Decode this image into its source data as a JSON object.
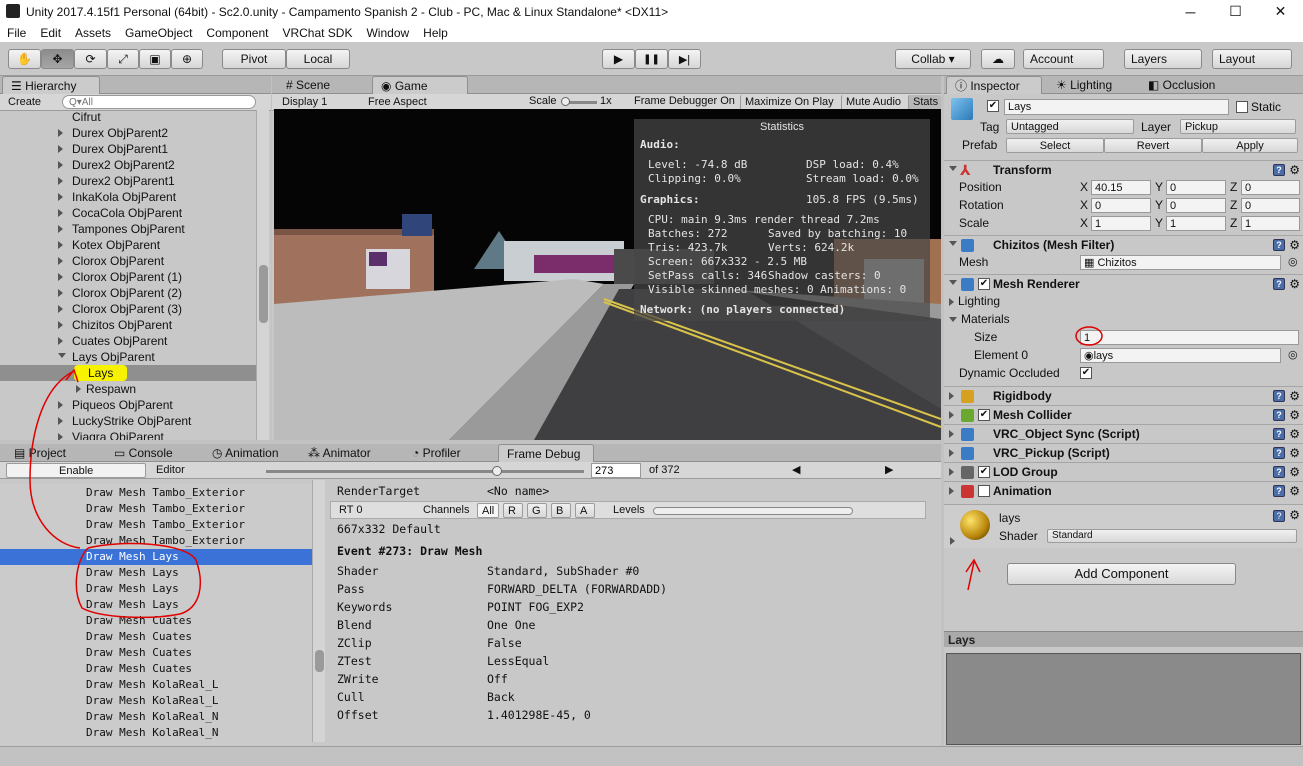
{
  "window": {
    "title": "Unity 2017.4.15f1 Personal (64bit) - Sc2.0.unity - Campamento Spanish 2 - Club - PC, Mac & Linux Standalone* <DX11>",
    "minimize": "─",
    "maximize": "☐",
    "close": "✕"
  },
  "menu": [
    "File",
    "Edit",
    "Assets",
    "GameObject",
    "Component",
    "VRChat SDK",
    "Window",
    "Help"
  ],
  "toolbar": {
    "tools": [
      "✋",
      "✥",
      "⟳",
      "⤢",
      "▣",
      "⊕"
    ],
    "pivot": "Pivot",
    "local": "Local",
    "play": "▶",
    "pause": "❚❚",
    "step": "▶|",
    "collab": "Collab ▾",
    "account": "Account",
    "layers": "Layers",
    "layout": "Layout"
  },
  "hierarchy": {
    "tab": "Hierarchy",
    "create": "Create",
    "search_placeholder": "Q▾All",
    "items": [
      {
        "label": "Cifrut",
        "arrow": false
      },
      {
        "label": "Durex ObjParent2",
        "arrow": true
      },
      {
        "label": "Durex ObjParent1",
        "arrow": true
      },
      {
        "label": "Durex2 ObjParent2",
        "arrow": true
      },
      {
        "label": "Durex2 ObjParent1",
        "arrow": true
      },
      {
        "label": "InkaKola ObjParent",
        "arrow": true
      },
      {
        "label": "CocaCola ObjParent",
        "arrow": true
      },
      {
        "label": "Tampones ObjParent",
        "arrow": true
      },
      {
        "label": "Kotex ObjParent",
        "arrow": true
      },
      {
        "label": "Clorox ObjParent",
        "arrow": true
      },
      {
        "label": "Clorox ObjParent (1)",
        "arrow": true
      },
      {
        "label": "Clorox ObjParent (2)",
        "arrow": true
      },
      {
        "label": "Clorox ObjParent (3)",
        "arrow": true
      },
      {
        "label": "Chizitos ObjParent",
        "arrow": true
      },
      {
        "label": "Cuates ObjParent",
        "arrow": true
      },
      {
        "label": "Lays ObjParent",
        "arrow": true
      },
      {
        "label": "Lays",
        "arrow": false
      },
      {
        "label": "Respawn",
        "arrow": true
      },
      {
        "label": "Piqueos ObjParent",
        "arrow": true
      },
      {
        "label": "LuckyStrike ObjParent",
        "arrow": true
      },
      {
        "label": "Viagra ObjParent",
        "arrow": true
      }
    ]
  },
  "scene_tabs": {
    "scene": "Scene",
    "game": "Game"
  },
  "game_bar": {
    "display": "Display 1",
    "aspect": "Free Aspect",
    "scale": "Scale",
    "scale_val": "1x",
    "frame_debugger": "Frame Debugger On",
    "maximize": "Maximize On Play",
    "mute": "Mute Audio",
    "stats": "Stats"
  },
  "stats": {
    "title": "Statistics",
    "audio": "Audio:",
    "level": "Level: -74.8 dB",
    "clipping": "Clipping: 0.0%",
    "dsp": "DSP load: 0.4%",
    "stream": "Stream load: 0.0%",
    "graphics": "Graphics:",
    "fps": "105.8 FPS (9.5ms)",
    "cpu": "CPU: main 9.3ms  render thread 7.2ms",
    "batches": "Batches: 272",
    "saved": "Saved by batching: 10",
    "tris": "Tris: 423.7k",
    "verts": "Verts: 624.2k",
    "screen": "Screen: 667x332 - 2.5 MB",
    "setpass": "SetPass calls: 346",
    "shadow": "Shadow casters: 0",
    "skinned": "Visible skinned meshes: 0  Animations: 0",
    "network": "Network: (no players connected)"
  },
  "bottom_tabs": [
    "Project",
    "Console",
    "Animation",
    "Animator",
    "Profiler",
    "Frame Debug"
  ],
  "frame_debug": {
    "enable": "Enable",
    "editor": "Editor",
    "event_value": "273",
    "event_total": "of 372",
    "list": [
      "Draw Mesh Tambo_Exterior",
      "Draw Mesh Tambo_Exterior",
      "Draw Mesh Tambo_Exterior",
      "Draw Mesh Tambo_Exterior",
      "Draw Mesh Lays",
      "Draw Mesh Lays",
      "Draw Mesh Lays",
      "Draw Mesh Lays",
      "Draw Mesh Cuates",
      "Draw Mesh Cuates",
      "Draw Mesh Cuates",
      "Draw Mesh Cuates",
      "Draw Mesh KolaReal_L",
      "Draw Mesh KolaReal_L",
      "Draw Mesh KolaReal_N",
      "Draw Mesh KolaReal_N"
    ],
    "render_target_label": "RenderTarget",
    "render_target": "<No name>",
    "rt": "RT 0",
    "channels": "Channels",
    "ch": [
      "All",
      "R",
      "G",
      "B",
      "A"
    ],
    "levels": "Levels",
    "resolution": "667x332 Default",
    "event_title": "Event #273: Draw Mesh",
    "props": [
      [
        "Shader",
        "Standard, SubShader #0"
      ],
      [
        "Pass",
        "FORWARD_DELTA (FORWARDADD)"
      ],
      [
        "Keywords",
        "POINT FOG_EXP2"
      ],
      [
        "Blend",
        "One One"
      ],
      [
        "ZClip",
        "False"
      ],
      [
        "ZTest",
        "LessEqual"
      ],
      [
        "ZWrite",
        "Off"
      ],
      [
        "Cull",
        "Back"
      ],
      [
        "Offset",
        "1.401298E-45, 0"
      ]
    ]
  },
  "inspector": {
    "tabs": [
      "Inspector",
      "Lighting",
      "Occlusion"
    ],
    "name": "Lays",
    "static": "Static",
    "tag_label": "Tag",
    "tag": "Untagged",
    "layer_label": "Layer",
    "layer": "Pickup",
    "prefab_label": "Prefab",
    "select": "Select",
    "revert": "Revert",
    "apply": "Apply",
    "transform": {
      "title": "Transform",
      "rows": [
        {
          "label": "Position",
          "x": "40.15",
          "y": "0",
          "z": "0"
        },
        {
          "label": "Rotation",
          "x": "0",
          "y": "0",
          "z": "0"
        },
        {
          "label": "Scale",
          "x": "1",
          "y": "1",
          "z": "1"
        }
      ]
    },
    "mesh_filter": {
      "title": "Chizitos (Mesh Filter)",
      "mesh_label": "Mesh",
      "mesh": "Chizitos"
    },
    "mesh_renderer": {
      "title": "Mesh Renderer",
      "lighting": "Lighting",
      "materials": "Materials",
      "size_label": "Size",
      "size": "1",
      "element_label": "Element 0",
      "element": "lays",
      "dynamic": "Dynamic Occluded"
    },
    "components": [
      "Rigidbody",
      "Mesh Collider",
      "VRC_Object Sync (Script)",
      "VRC_Pickup (Script)",
      "LOD Group",
      "Animation"
    ],
    "material": {
      "name": "lays",
      "shader_label": "Shader",
      "shader": "Standard"
    },
    "add_component": "Add Component",
    "preview_title": "Lays"
  }
}
